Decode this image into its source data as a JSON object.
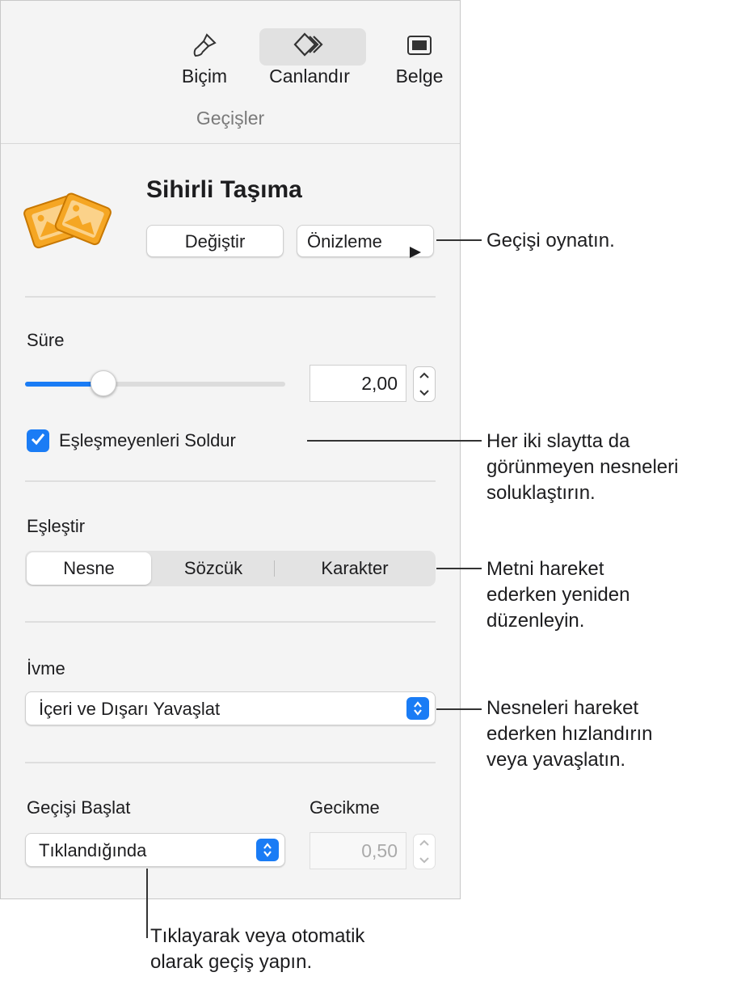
{
  "toolbar": {
    "tabs": [
      {
        "label": "Biçim",
        "icon": "paintbrush-icon"
      },
      {
        "label": "Canlandır",
        "icon": "diamond-icon",
        "active": true
      },
      {
        "label": "Belge",
        "icon": "document-icon"
      }
    ]
  },
  "subheader": {
    "title": "Geçişler"
  },
  "transition": {
    "name": "Sihirli Taşıma",
    "icon": "magic-move-icon",
    "change_label": "Değiştir",
    "preview_label": "Önizleme"
  },
  "duration": {
    "label": "Süre",
    "value": "2,00",
    "slider_fraction": 0.3
  },
  "fade": {
    "label": "Eşleşmeyenleri Soldur",
    "checked": true
  },
  "match": {
    "label": "Eşleştir",
    "options": [
      "Nesne",
      "Sözcük",
      "Karakter"
    ],
    "selected": "Nesne"
  },
  "acceleration": {
    "label": "İvme",
    "value": "İçeri ve Dışarı Yavaşlat"
  },
  "start": {
    "label": "Geçişi Başlat",
    "value": "Tıklandığında"
  },
  "delay": {
    "label": "Gecikme",
    "value": "0,50"
  },
  "colors": {
    "accent": "#1a7cf5",
    "icon_orange": "#f5a623"
  },
  "callouts": {
    "preview": "Geçişi oynatın.",
    "fade": [
      "Her iki slaytta da",
      "görünmeyen nesneleri",
      "soluklaştırın."
    ],
    "match": [
      "Metni hareket",
      "ederken yeniden",
      "düzenleyin."
    ],
    "acceleration": [
      "Nesneleri hareket",
      "ederken hızlandırın",
      "veya yavaşlatın."
    ],
    "start": [
      "Tıklayarak veya otomatik",
      "olarak geçiş yapın."
    ]
  }
}
